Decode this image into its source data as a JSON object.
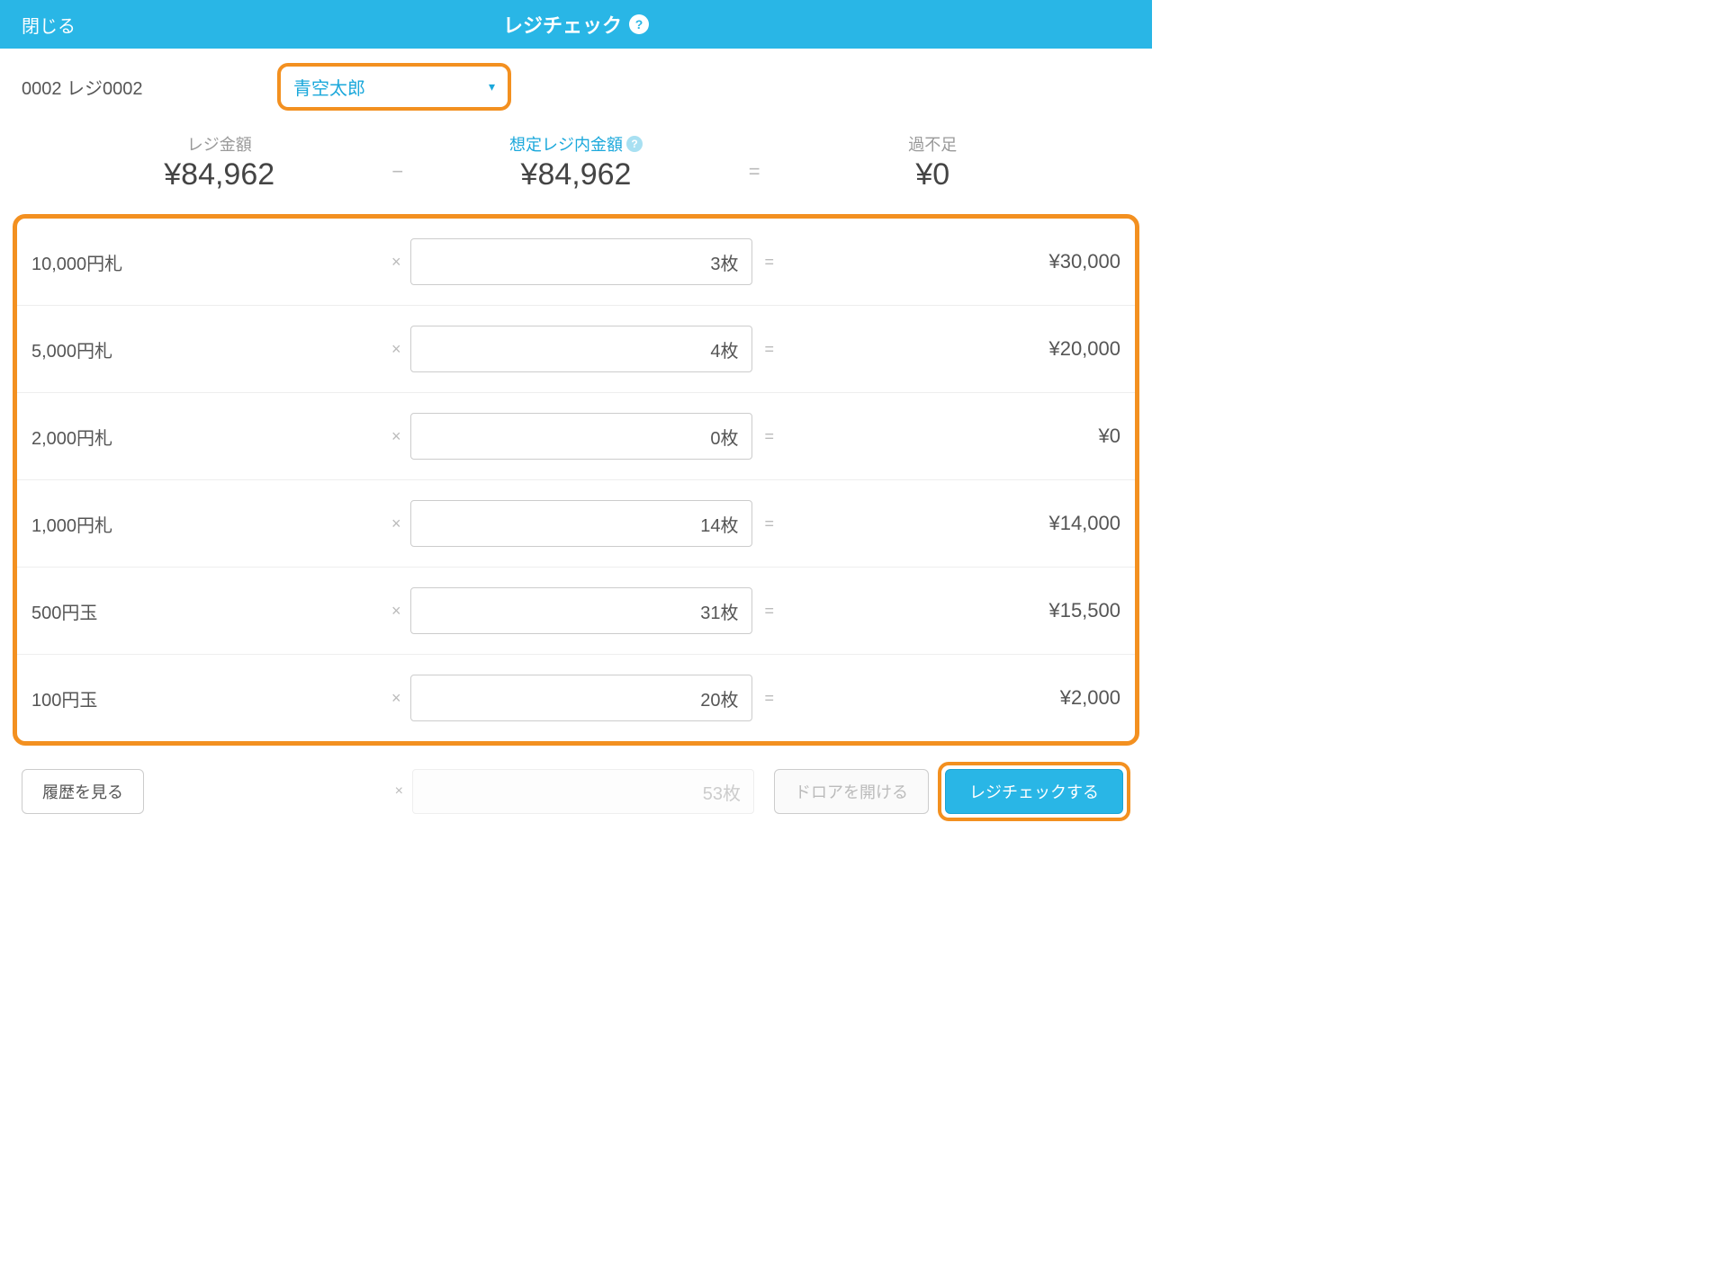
{
  "header": {
    "close": "閉じる",
    "title": "レジチェック"
  },
  "subheader": {
    "register": "0002 レジ0002",
    "staff": "青空太郎"
  },
  "summary": {
    "cash_label": "レジ金額",
    "cash_value": "¥84,962",
    "minus": "−",
    "expected_label": "想定レジ内金額",
    "expected_value": "¥84,962",
    "equals": "=",
    "diff_label": "過不足",
    "diff_value": "¥0"
  },
  "denominations": [
    {
      "label": "10,000円札",
      "count": "3枚",
      "total": "¥30,000"
    },
    {
      "label": "5,000円札",
      "count": "4枚",
      "total": "¥20,000"
    },
    {
      "label": "2,000円札",
      "count": "0枚",
      "total": "¥0"
    },
    {
      "label": "1,000円札",
      "count": "14枚",
      "total": "¥14,000"
    },
    {
      "label": "500円玉",
      "count": "31枚",
      "total": "¥15,500"
    },
    {
      "label": "100円玉",
      "count": "20枚",
      "total": "¥2,000"
    }
  ],
  "symbols": {
    "mult": "×",
    "eq": "="
  },
  "footer": {
    "history": "履歴を見る",
    "extra_count": "53枚",
    "open_drawer": "ドロアを開ける",
    "submit": "レジチェックする"
  }
}
